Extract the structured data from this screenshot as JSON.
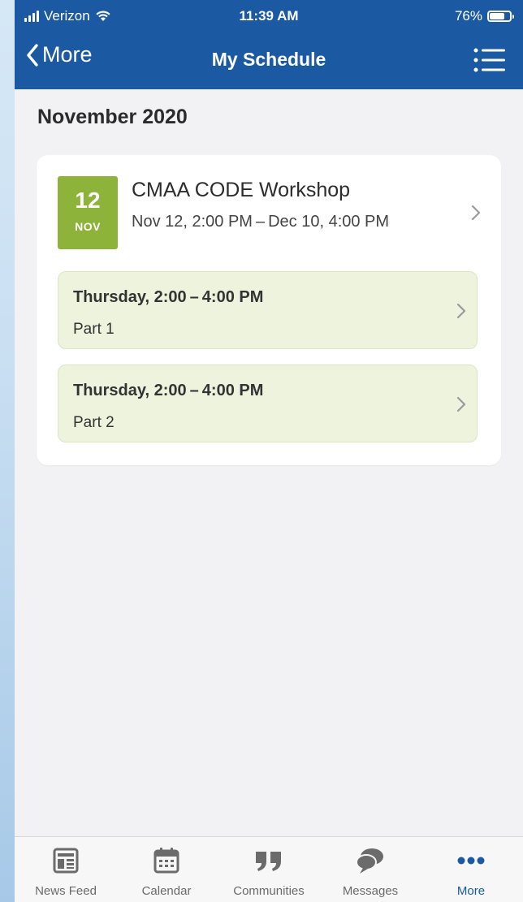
{
  "status_bar": {
    "carrier": "Verizon",
    "time": "11:39 AM",
    "battery_text": "76%",
    "battery_level": 0.76
  },
  "nav": {
    "back_label": "More",
    "title": "My Schedule"
  },
  "month_heading": "November 2020",
  "event": {
    "day": "12",
    "month": "NOV",
    "title": "CMAA CODE Workshop",
    "date_range": "Nov 12, 2:00 PM – Dec 10, 4:00 PM",
    "badge_color": "#8eb33b",
    "sessions": [
      {
        "time": "Thursday, 2:00 – 4:00 PM",
        "label": "Part 1"
      },
      {
        "time": "Thursday, 2:00 – 4:00 PM",
        "label": "Part 2"
      }
    ]
  },
  "tabbar": {
    "active_color": "#1b5aa3",
    "tabs": [
      {
        "label": "News Feed",
        "icon": "news-feed-icon"
      },
      {
        "label": "Calendar",
        "icon": "calendar-icon"
      },
      {
        "label": "Communities",
        "icon": "communities-icon"
      },
      {
        "label": "Messages",
        "icon": "messages-icon"
      },
      {
        "label": "More",
        "icon": "more-icon",
        "active": true
      }
    ]
  }
}
